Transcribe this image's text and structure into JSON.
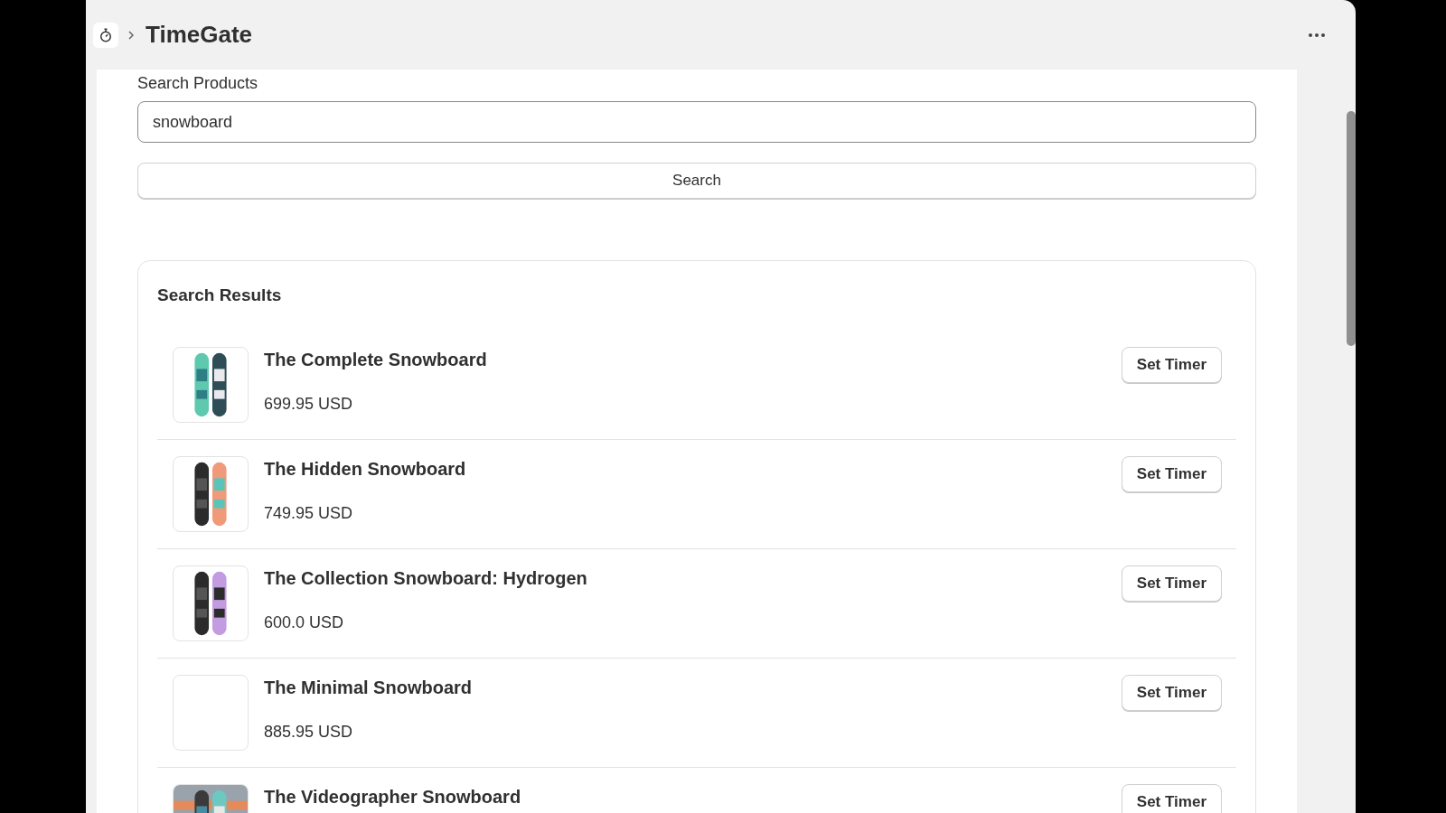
{
  "header": {
    "title": "TimeGate"
  },
  "search": {
    "label": "Search Products",
    "value": "snowboard",
    "button": "Search"
  },
  "results": {
    "title": "Search Results",
    "items": [
      {
        "name": "The Complete Snowboard",
        "price": "699.95 USD",
        "kind": "picture",
        "action": "Set Timer"
      },
      {
        "name": "The Hidden Snowboard",
        "price": "749.95 USD",
        "kind": "picture",
        "action": "Set Timer"
      },
      {
        "name": "The Collection Snowboard: Hydrogen",
        "price": "600.0 USD",
        "kind": "picture",
        "action": "Set Timer"
      },
      {
        "name": "The Minimal Snowboard",
        "price": "885.95 USD",
        "kind": "blank",
        "action": "Set Timer"
      },
      {
        "name": "The Videographer Snowboard",
        "kind": "picture",
        "action": "Set Timer"
      }
    ]
  }
}
